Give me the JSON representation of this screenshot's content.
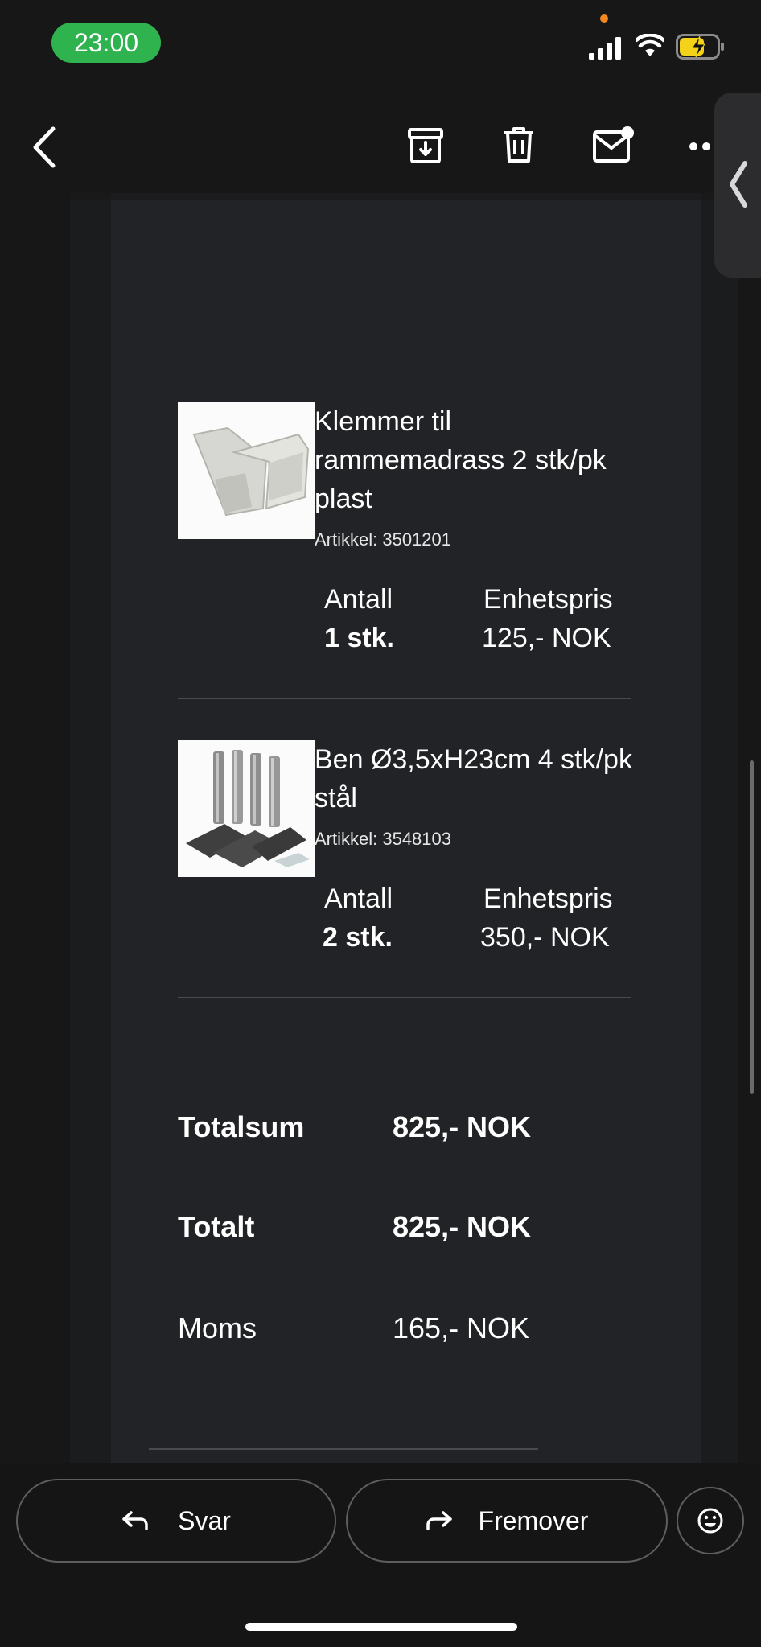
{
  "status_bar": {
    "time": "23:00"
  },
  "toolbar": {
    "back_icon": "chevron-left-icon",
    "archive_icon": "archive-icon",
    "delete_icon": "trash-icon",
    "unread_icon": "mail-unread-icon",
    "more_icon": "more-horizontal-icon"
  },
  "email": {
    "products": [
      {
        "name": "Klemmer til rammemadrass 2 stk/pk plast",
        "article": "Artikkel: 3501201",
        "qty_label": "Antall",
        "qty": "1 stk.",
        "price_label": "Enhetspris",
        "price": "125,- NOK"
      },
      {
        "name": "Ben Ø3,5xH23cm 4 stk/pk stål",
        "article": "Artikkel: 3548103",
        "qty_label": "Antall",
        "qty": "2 stk.",
        "price_label": "Enhetspris",
        "price": "350,- NOK"
      }
    ],
    "summary": {
      "totalsum_label": "Totalsum",
      "totalsum_value": "825,- NOK",
      "totalt_label": "Totalt",
      "totalt_value": "825,- NOK",
      "moms_label": "Moms",
      "moms_value": "165,- NOK"
    }
  },
  "actions": {
    "reply_label": "Svar",
    "forward_label": "Fremover",
    "emoji_icon": "emoji-icon"
  },
  "colors": {
    "status_pill": "#2fb34f",
    "card_bg": "#222326",
    "battery_fill": "#f5d21a"
  }
}
